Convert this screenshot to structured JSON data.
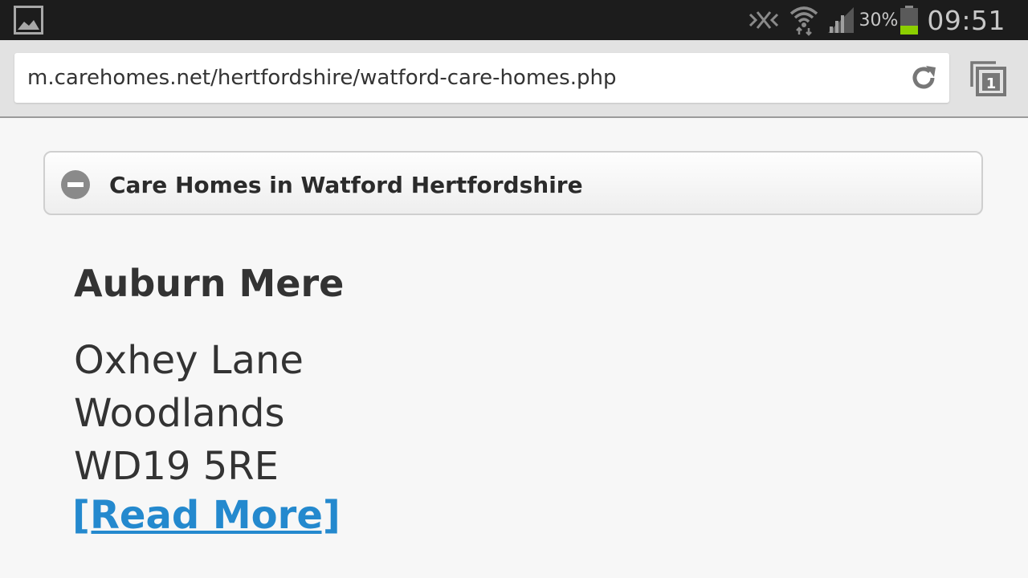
{
  "status_bar": {
    "battery_percent": "30%",
    "time": "09:51",
    "icons": [
      "image-notification-icon",
      "nfc-icon",
      "wifi-icon",
      "signal-icon",
      "battery-icon"
    ]
  },
  "browser": {
    "url": "m.carehomes.net/hertfordshire/watford-care-homes.php",
    "tab_count": "1",
    "icons": [
      "reload-icon",
      "tabs-icon"
    ]
  },
  "page": {
    "section_title": "Care Homes in Watford Hertfordshire",
    "listing": {
      "name": "Auburn Mere",
      "address_lines": [
        "Oxhey Lane",
        "Woodlands",
        "WD19 5RE"
      ],
      "read_more": "[Read More]"
    }
  },
  "colors": {
    "link": "#2489ce",
    "battery_level": "#8ccf00",
    "status_bar_bg": "#1c1c1c"
  }
}
